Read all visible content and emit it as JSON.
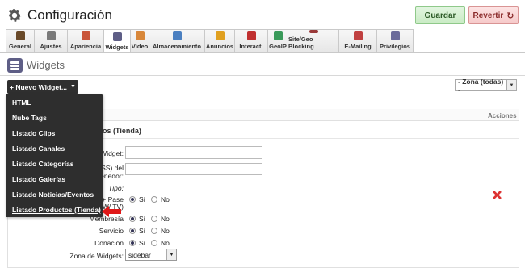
{
  "header": {
    "title": "Configuración",
    "save_label": "Guardar",
    "revert_label": "Revertir"
  },
  "tabs": [
    {
      "label": "General",
      "icon": "general-icon",
      "color": "#6a4a2a"
    },
    {
      "label": "Ajustes",
      "icon": "settings-icon",
      "color": "#7a7a7a"
    },
    {
      "label": "Apariencia",
      "icon": "palette-icon",
      "color": "#c9553a"
    },
    {
      "label": "Widgets",
      "icon": "widgets-icon",
      "color": "#5e5e86",
      "active": true
    },
    {
      "label": "Vídeo",
      "icon": "video-icon",
      "color": "#d8873a"
    },
    {
      "label": "Almacenamiento",
      "icon": "storage-icon",
      "color": "#4a7fc0"
    },
    {
      "label": "Anuncios",
      "icon": "ads-icon",
      "color": "#e0a020"
    },
    {
      "label": "Interact.",
      "icon": "interact-icon",
      "color": "#c03030"
    },
    {
      "label": "GeoIP",
      "icon": "geoip-icon",
      "color": "#3a9a5a"
    },
    {
      "label": "Site/Geo Blocking",
      "icon": "blocking-icon",
      "color": "#9a3a3a"
    },
    {
      "label": "E-Mailing",
      "icon": "email-icon",
      "color": "#c04040"
    },
    {
      "label": "Privilegios",
      "icon": "users-icon",
      "color": "#6a6a9a"
    }
  ],
  "section": {
    "title": "Widgets"
  },
  "add_widget": {
    "label": "+ Nuevo Widget...",
    "menu": [
      "HTML",
      "Nube Tags",
      "Listado Clips",
      "Listado Canales",
      "Listado Categorías",
      "Listado Galerías",
      "Listado Noticias/Eventos",
      "Listado Productos (Tienda)"
    ]
  },
  "zone_filter": {
    "value": "- Zona (todas) -"
  },
  "table": {
    "header_left": "s",
    "header_right": "Acciones",
    "row_title": "os (Tienda)",
    "fields": {
      "widget_label": "Widget:",
      "css_label_1": "CSS) del",
      "css_label_2": "enedor:",
      "tipo_label": "Tipo:",
      "pase_label_1": "+ Pase",
      "pase_label_2": "W/ TV)",
      "membresia_label": "Membresía",
      "servicio_label": "Servicio",
      "donacion_label": "Donación",
      "zona_label": "Zona de Widgets:",
      "zona_value": "sidebar",
      "si": "Sí",
      "no": "No"
    }
  },
  "colors": {
    "accent_dark": "#2e2e2e",
    "save_green": "#c9ebc4",
    "revert_red": "#f6c9c9",
    "delete_red": "#d33"
  }
}
